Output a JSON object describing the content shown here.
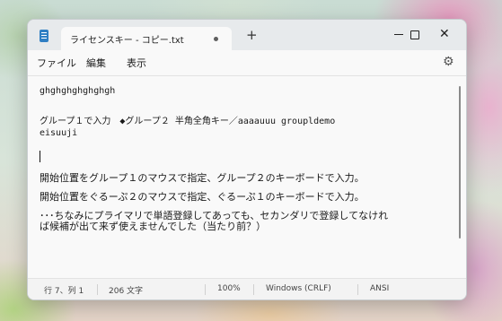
{
  "window": {
    "tab_title": "ライセンスキー - コピー.txt",
    "new_tab_symbol": "+",
    "close_symbol": "✕"
  },
  "menu": {
    "file": "ファイル",
    "edit": "編集",
    "view": "表示"
  },
  "settings_icon": "⚙",
  "editor": {
    "lines": [
      "ghghghghghghgh",
      "グループ１で入力　◆グループ２ 半角全角キー／aaaauuu groupldemo",
      "eisuuji",
      "開始位置をグループ１のマウスで指定、グループ２のキーボードで入力。",
      "開始位置をぐるーぷ２のマウスで指定、ぐるーぷ１のキーボードで入力。",
      "･･･ちなみにプライマリで単語登録してあっても、セカンダリで登録してなけれ",
      "ば候補が出て来ず使えませんでした（当たり前？）"
    ]
  },
  "status": {
    "position": "行 7、列 1",
    "char_count": "206 文字",
    "zoom": "100%",
    "line_ending": "Windows (CRLF)",
    "encoding": "ANSI"
  }
}
